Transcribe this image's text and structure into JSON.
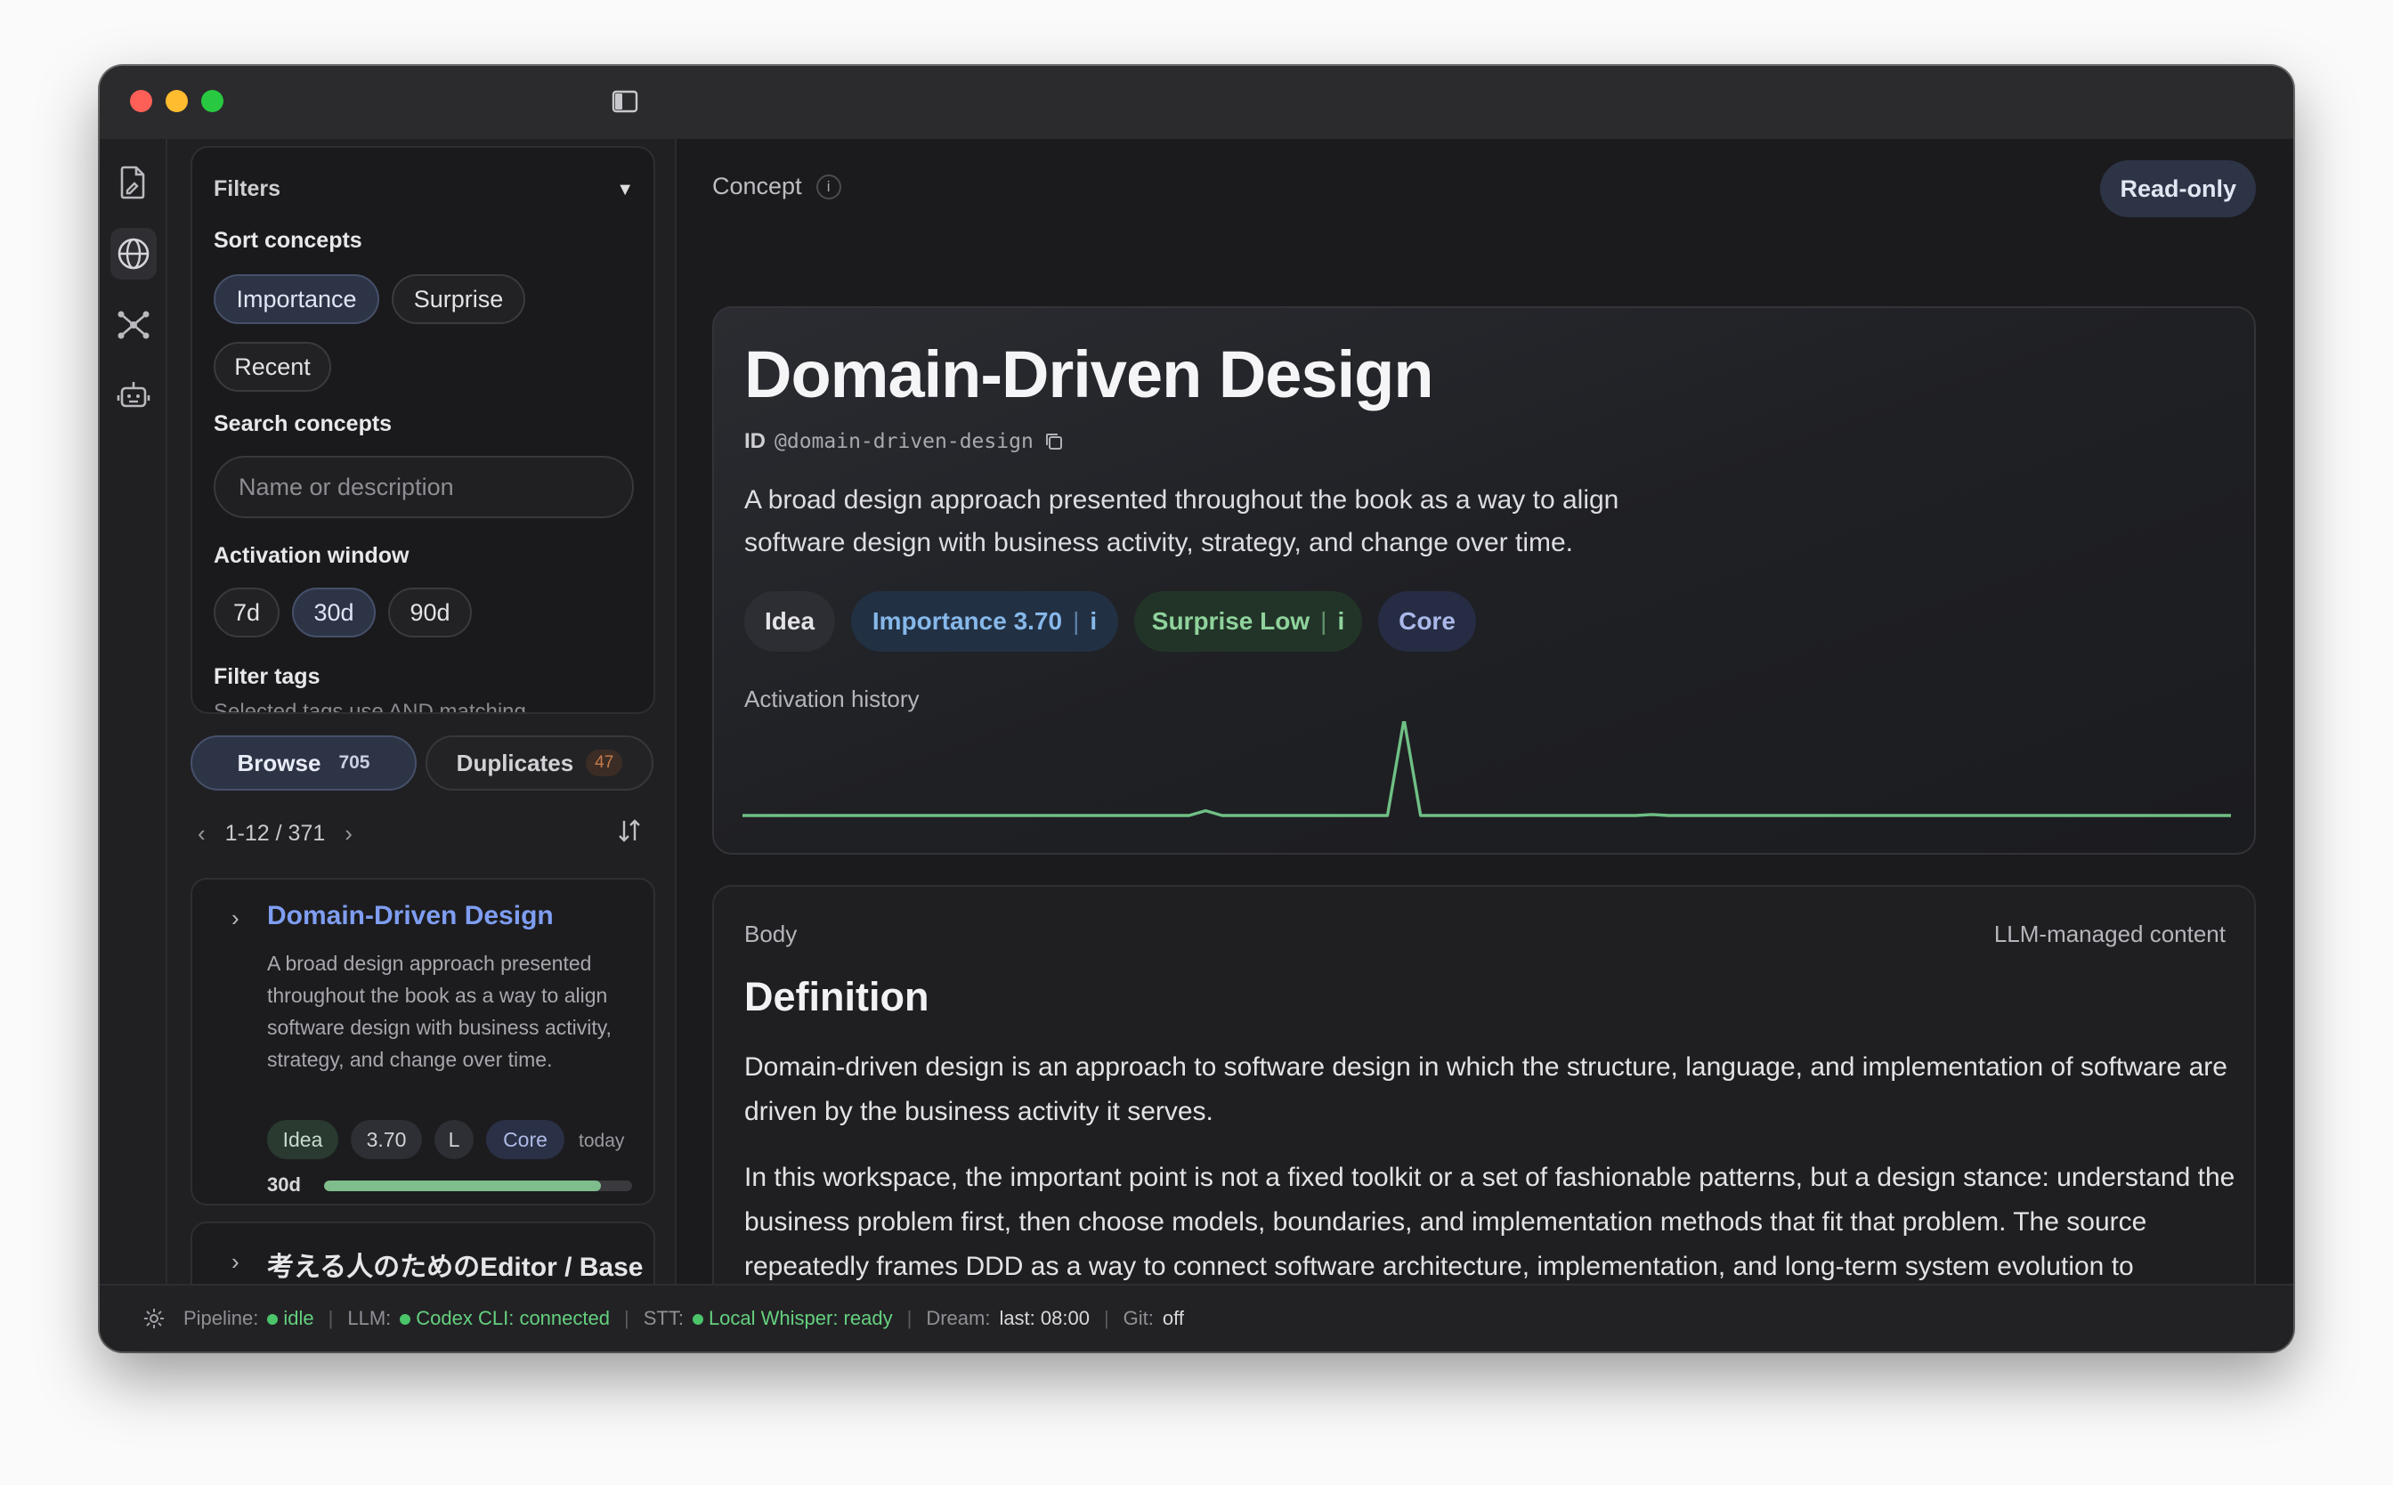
{
  "window": {
    "controls": [
      "close",
      "minimize",
      "zoom"
    ]
  },
  "rail": {
    "icons": [
      "document-edit-icon",
      "globe-icon",
      "graph-nodes-icon",
      "robot-icon"
    ],
    "active": "globe-icon"
  },
  "filters": {
    "header": "Filters",
    "sort_label": "Sort concepts",
    "sort_options": [
      "Importance",
      "Surprise",
      "Recent"
    ],
    "sort_selected": "Importance",
    "search_label": "Search concepts",
    "search_placeholder": "Name or description",
    "window_label": "Activation window",
    "window_options": [
      "7d",
      "30d",
      "90d"
    ],
    "window_selected": "30d",
    "tags_label": "Filter tags",
    "tags_hint": "Selected tags use AND matching"
  },
  "tabs": {
    "browse": {
      "label": "Browse",
      "count": "705"
    },
    "duplicates": {
      "label": "Duplicates",
      "count": "47"
    }
  },
  "pager": {
    "range": "1-12 / 371"
  },
  "list": [
    {
      "title": "Domain-Driven Design",
      "description": "A broad design approach presented throughout the book as a way to align software design with business activity, strategy, and change over time.",
      "chips": {
        "type": "Idea",
        "importance": "3.70",
        "surprise": "L",
        "tier": "Core"
      },
      "updated": "today",
      "window": "30d",
      "activity_fraction": 0.9
    },
    {
      "title": "考える人のためのEditor / Base"
    }
  ],
  "concept": {
    "crumb": "Concept",
    "readonly_label": "Read-only",
    "title": "Domain-Driven Design",
    "id_label": "ID",
    "id_value": "@domain-driven-design",
    "lead": "A broad design approach presented throughout the book as a way to align software design with business activity, strategy, and change over time.",
    "badges": {
      "type": "Idea",
      "importance": "Importance 3.70",
      "surprise": "Surprise Low",
      "info": "i",
      "tier": "Core"
    },
    "activity_label": "Activation history",
    "activity_series": [
      0,
      0,
      0,
      0,
      0,
      0,
      0,
      0,
      0,
      0,
      0,
      0,
      0,
      0,
      0,
      0,
      0,
      0,
      0,
      0,
      0,
      0,
      0,
      0,
      0,
      0,
      0,
      0,
      0.05,
      0,
      0,
      0,
      0,
      0,
      0,
      0,
      0,
      0,
      0,
      0,
      1,
      0,
      0,
      0,
      0,
      0,
      0,
      0,
      0,
      0,
      0,
      0,
      0,
      0,
      0,
      0.01,
      0,
      0,
      0,
      0,
      0,
      0,
      0,
      0,
      0,
      0,
      0,
      0,
      0,
      0,
      0,
      0,
      0,
      0,
      0,
      0,
      0,
      0,
      0,
      0,
      0,
      0,
      0,
      0,
      0,
      0,
      0,
      0,
      0,
      0,
      0
    ]
  },
  "body": {
    "label": "Body",
    "managed_label": "LLM-managed content",
    "heading": "Definition",
    "paragraphs": [
      "Domain-driven design is an approach to software design in which the structure, language, and implementation of software are driven by the business activity it serves.",
      "In this workspace, the important point is not a fixed toolkit or a set of fashionable patterns, but a design stance: understand the business problem first, then choose models, boundaries, and implementation methods that fit that problem. The source repeatedly frames DDD as a way to connect software architecture, implementation, and long-term system evolution to business goals rather than treating software as an isolated technical artifact."
    ]
  },
  "status": {
    "pipeline_label": "Pipeline:",
    "pipeline_value": "idle",
    "llm_label": "LLM:",
    "llm_value": "Codex CLI: connected",
    "stt_label": "STT:",
    "stt_value": "Local Whisper: ready",
    "dream_label": "Dream:",
    "dream_value": "last: 08:00",
    "git_label": "Git:",
    "git_value": "off"
  },
  "colors": {
    "accent": "#7f9ef2",
    "chart_line": "#6fbf84",
    "ok": "#64d07e"
  }
}
